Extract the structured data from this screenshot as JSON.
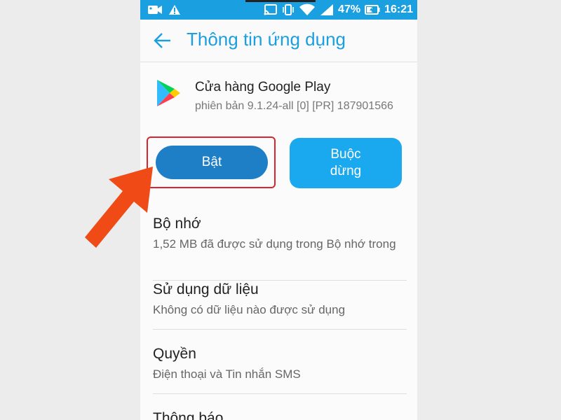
{
  "status_bar": {
    "battery": "47%",
    "time": "16:21"
  },
  "app_bar": {
    "title": "Thông tin ứng dụng"
  },
  "app": {
    "name": "Cửa hàng Google Play",
    "version": "phiên bản 9.1.24-all [0] [PR] 187901566"
  },
  "buttons": {
    "enable": "Bật",
    "force_stop": "Buộc dừng"
  },
  "sections": [
    {
      "title": "Bộ nhớ",
      "subtitle": "1,52 MB đã được sử dụng trong Bộ nhớ trong"
    },
    {
      "title": "Sử dụng dữ liệu",
      "subtitle": "Không có dữ liệu nào được sử dụng"
    },
    {
      "title": "Quyền",
      "subtitle": "Điện thoại và Tin nhắn SMS"
    },
    {
      "title": "Thông báo",
      "subtitle": ""
    }
  ],
  "colors": {
    "accent": "#1a9fe0",
    "enable_button": "#1f7fc6",
    "force_stop_button": "#1aa8ee",
    "highlight": "#d9262e",
    "arrow": "#f04a16"
  },
  "icons": [
    "video-camera-icon",
    "warning-icon",
    "cast-icon",
    "vibrate-icon",
    "wifi-icon",
    "signal-icon",
    "battery-charging-icon",
    "back-arrow-icon",
    "google-play-icon",
    "pointer-arrow-icon"
  ]
}
